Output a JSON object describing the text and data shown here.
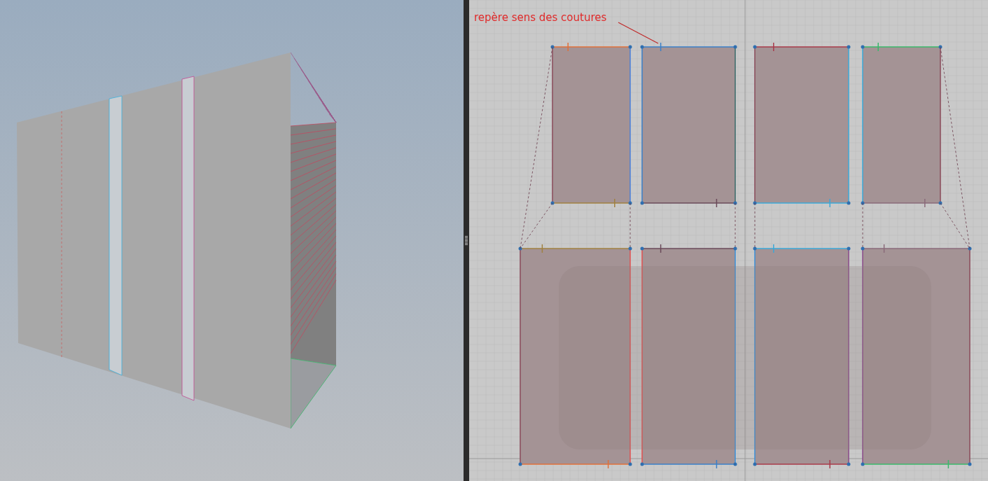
{
  "pattern_view": {
    "annotation": {
      "text": "repère sens des coutures"
    }
  }
}
